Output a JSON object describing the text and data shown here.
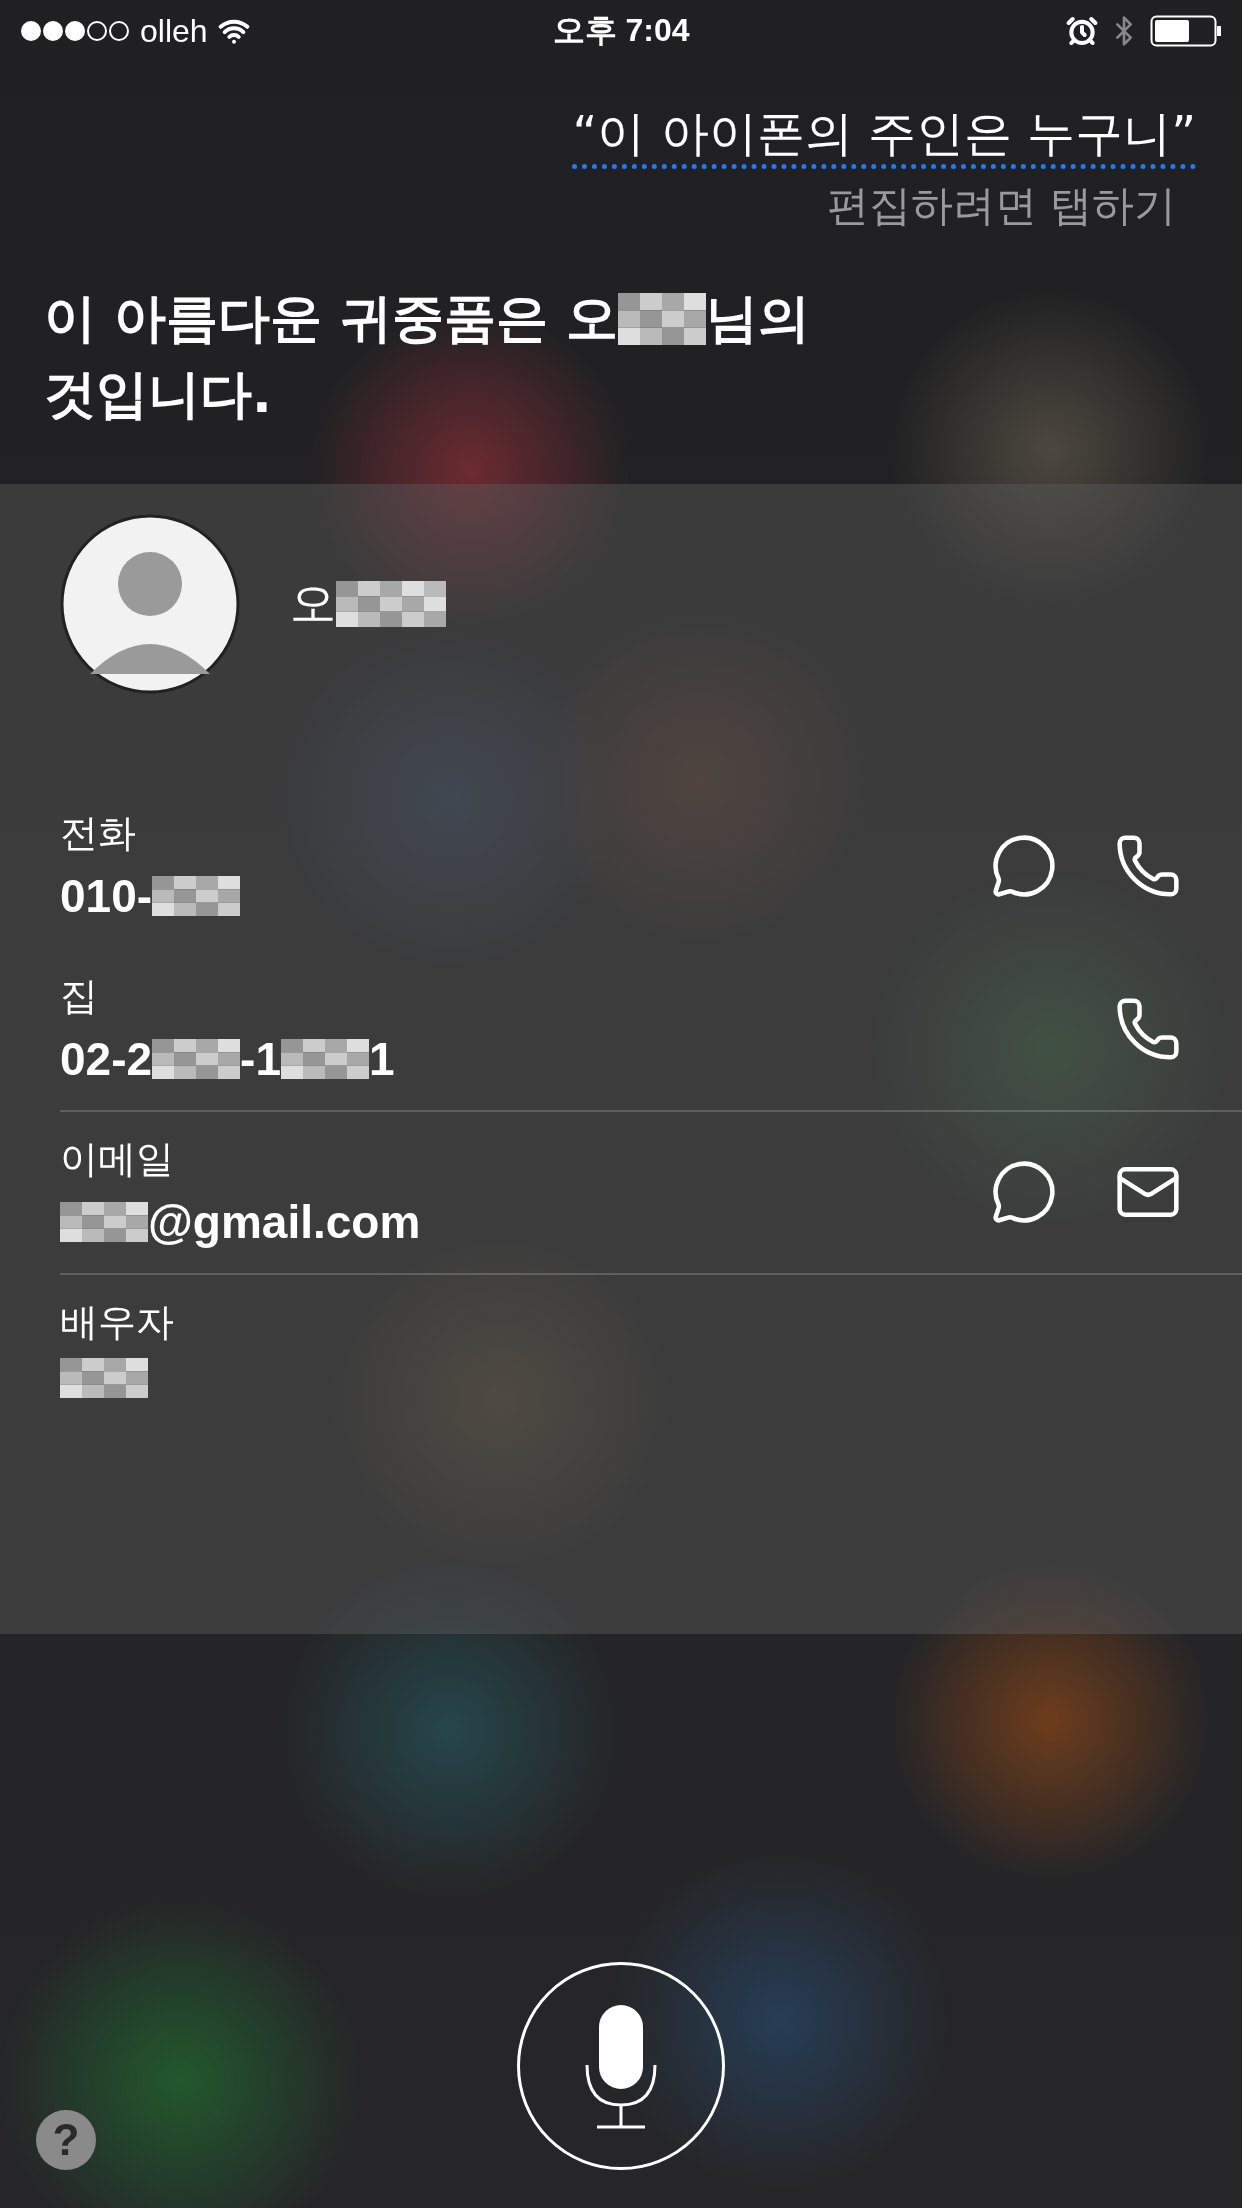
{
  "status_bar": {
    "carrier": "olleh",
    "time": "오후 7:04"
  },
  "query": {
    "text": "“이 아이폰의 주인은 누구니”",
    "hint": "편집하려면 탭하기"
  },
  "answer": {
    "lines": [
      [
        {
          "kind": "text",
          "text": "이 아름다운 귀중품은 오"
        },
        {
          "kind": "redacted"
        },
        {
          "kind": "text",
          "text": "님의"
        }
      ],
      [
        {
          "kind": "text",
          "text": "것입니다."
        }
      ]
    ]
  },
  "contact": {
    "name": [
      {
        "kind": "text",
        "text": "오"
      },
      {
        "kind": "redacted"
      }
    ],
    "fields": [
      {
        "label": "전화",
        "divided": false,
        "value": [
          {
            "kind": "text",
            "text": "010-"
          },
          {
            "kind": "redacted"
          }
        ],
        "actions": [
          {
            "kind": "message"
          },
          {
            "kind": "phone"
          }
        ]
      },
      {
        "label": "집",
        "divided": false,
        "value": [
          {
            "kind": "text",
            "text": "02-2"
          },
          {
            "kind": "redacted"
          },
          {
            "kind": "text",
            "text": "-1"
          },
          {
            "kind": "redacted"
          },
          {
            "kind": "text",
            "text": "1"
          }
        ],
        "actions": [
          {
            "kind": "phone"
          }
        ]
      },
      {
        "label": "이메일",
        "divided": true,
        "value": [
          {
            "kind": "redacted"
          },
          {
            "kind": "text",
            "text": "@gmail.com"
          }
        ],
        "actions": [
          {
            "kind": "message"
          },
          {
            "kind": "mail"
          }
        ]
      },
      {
        "label": "배우자",
        "divided": true,
        "value": [
          {
            "kind": "redacted"
          }
        ]
      }
    ]
  },
  "help": {
    "text": "?"
  }
}
